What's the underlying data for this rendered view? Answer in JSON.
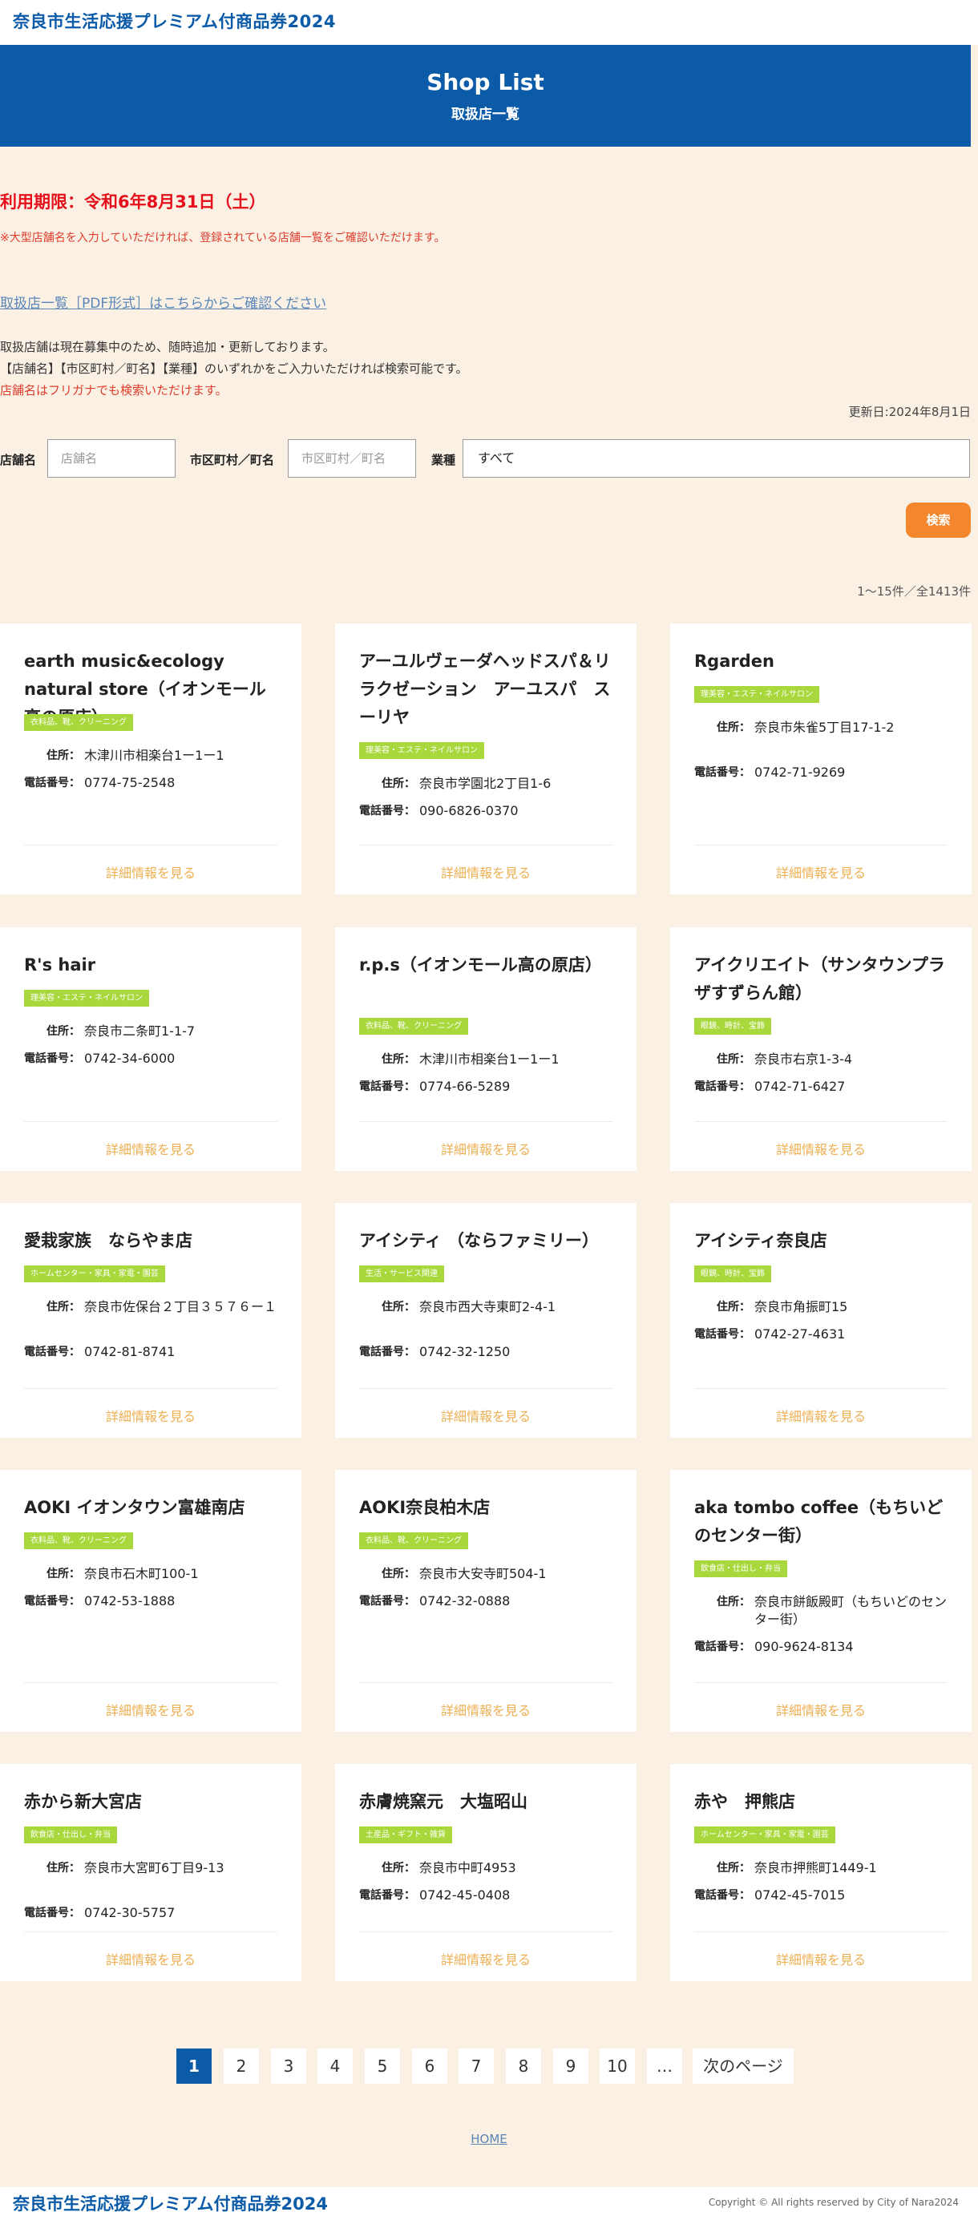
{
  "site": {
    "title": "奈良市生活応援プレミアム付商品券2024"
  },
  "hero": {
    "title": "Shop List",
    "subtitle": "取扱店一覧"
  },
  "intro": {
    "deadline": "利用期限：令和6年8月31日（土）",
    "note": "※大型店舗名を入力していただければ、登録されている店舗一覧をご確認いただけます。",
    "pdf_link": "取扱店一覧［PDF形式］はこちらからご確認ください",
    "info1": "取扱店舗は現在募集中のため、随時追加・更新しております。",
    "info2": "【店舗名】【市区町村／町名】【業種】のいずれかをご入力いただければ検索可能です。",
    "info3": "店舗名はフリガナでも検索いただけます。",
    "updated": "更新日:2024年8月1日"
  },
  "search": {
    "store_label": "店舗名",
    "store_placeholder": "店舗名",
    "area_label": "市区町村／町名",
    "area_placeholder": "市区町村／町名",
    "category_label": "業種",
    "category_value": "すべて",
    "button": "検索"
  },
  "result_count": "1〜15件／全1413件",
  "labels": {
    "address": "住所：",
    "phone": "電話番号：",
    "detail": "詳細情報を見る"
  },
  "shops": [
    {
      "name": "earth music&ecology natural store（イオンモール高の原店）",
      "category": "衣料品、靴、クリーニング",
      "address": "木津川市相楽台1ー1ー1",
      "phone": "0774-75-2548"
    },
    {
      "name": "アーユルヴェーダヘッドスパ＆リラクゼーション　アーユスパ　スーリヤ",
      "category": "理美容・エステ・ネイルサロン",
      "address": "奈良市学園北2丁目1-6",
      "phone": "090-6826-0370"
    },
    {
      "name": "Rgarden",
      "category": "理美容・エステ・ネイルサロン",
      "address": "奈良市朱雀5丁目17-1-2",
      "phone": "0742-71-9269"
    },
    {
      "name": "R's hair",
      "category": "理美容・エステ・ネイルサロン",
      "address": "奈良市二条町1-1-7",
      "phone": "0742-34-6000"
    },
    {
      "name": "r.p.s（イオンモール高の原店）",
      "category": "衣料品、靴、クリーニング",
      "address": "木津川市相楽台1ー1ー1",
      "phone": "0774-66-5289"
    },
    {
      "name": "アイクリエイト（サンタウンプラザすずらん館）",
      "category": "眼鏡、時計、宝飾",
      "address": "奈良市右京1-3-4",
      "phone": "0742-71-6427"
    },
    {
      "name": "愛栽家族　ならやま店",
      "category": "ホームセンター・家具・家電・園芸",
      "address": "奈良市佐保台２丁目３５７６ー１",
      "phone": "0742-81-8741"
    },
    {
      "name": "アイシティ （ならファミリー）",
      "category": "生活・サービス関連",
      "address": "奈良市西大寺東町2-4-1",
      "phone": "0742-32-1250"
    },
    {
      "name": "アイシティ奈良店",
      "category": "眼鏡、時計、宝飾",
      "address": "奈良市角振町15",
      "phone": "0742-27-4631"
    },
    {
      "name": "AOKI イオンタウン富雄南店",
      "category": "衣料品、靴、クリーニング",
      "address": "奈良市石木町100-1",
      "phone": "0742-53-1888"
    },
    {
      "name": "AOKI奈良柏木店",
      "category": "衣料品、靴、クリーニング",
      "address": "奈良市大安寺町504-1",
      "phone": "0742-32-0888"
    },
    {
      "name": "aka tombo coffee（もちいどのセンター街）",
      "category": "飲食店・仕出し・弁当",
      "address": "奈良市餅飯殿町（もちいどのセンター街）",
      "phone": "090-9624-8134"
    },
    {
      "name": "赤から新大宮店",
      "category": "飲食店・仕出し・弁当",
      "address": "奈良市大宮町6丁目9-13",
      "phone": "0742-30-5757"
    },
    {
      "name": "赤膚焼窯元　大塩昭山",
      "category": "土産品・ギフト・雑貨",
      "address": "奈良市中町4953",
      "phone": "0742-45-0408"
    },
    {
      "name": "赤や　押熊店",
      "category": "ホームセンター・家具・家電・園芸",
      "address": "奈良市押熊町1449-1",
      "phone": "0742-45-7015"
    }
  ],
  "pagination": {
    "pages": [
      "1",
      "2",
      "3",
      "4",
      "5",
      "6",
      "7",
      "8",
      "9",
      "10"
    ],
    "current": "1",
    "ellipsis": "…",
    "next": "次のページ"
  },
  "nav": {
    "home": "HOME"
  },
  "footer": {
    "title": "奈良市生活応援プレミアム付商品券2024",
    "copyright": "Copyright © All rights reserved by City of Nara2024"
  },
  "colors": {
    "brand_blue": "#0b5ba8",
    "accent_orange": "#f4872d",
    "tag_green": "#a8d83c",
    "deadline_red": "#e5101b",
    "link_gold": "#eeaf52",
    "background": "#faf1e4"
  }
}
